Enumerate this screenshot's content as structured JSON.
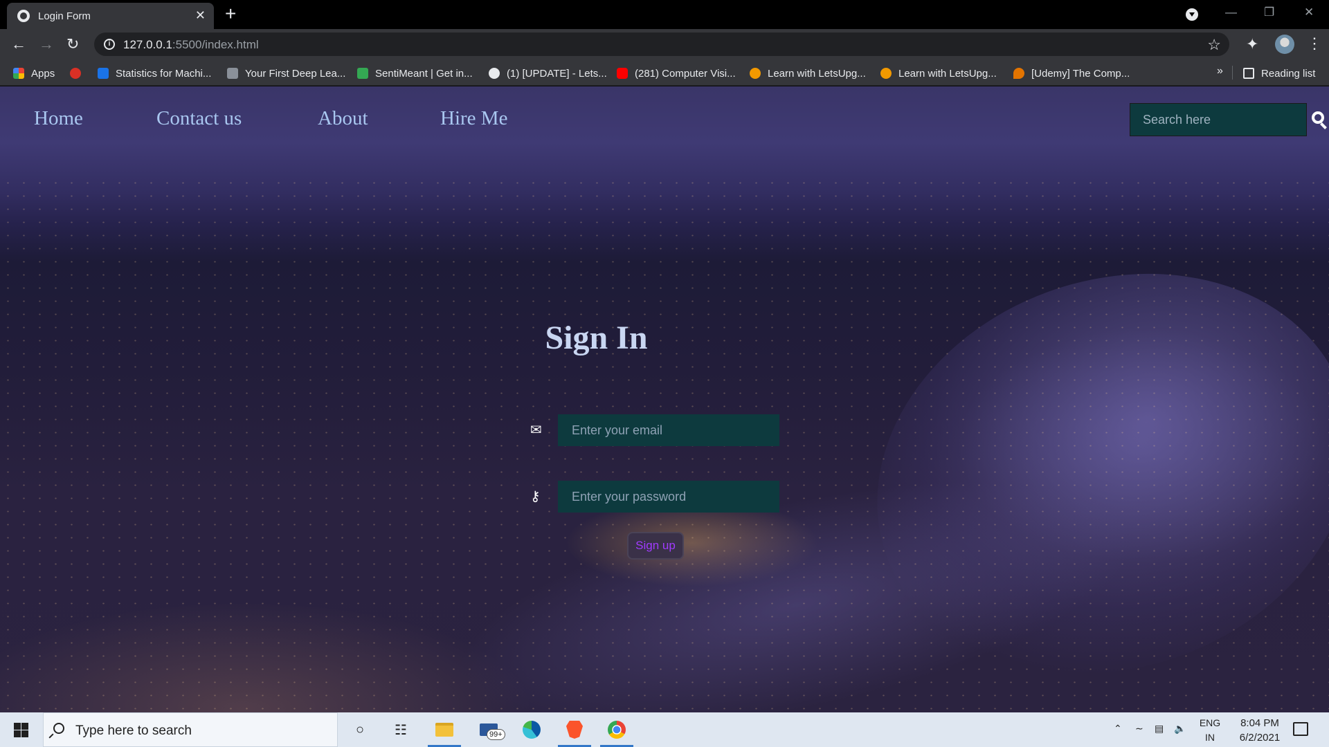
{
  "browser": {
    "tab_title": "Login Form",
    "close_symbol": "✕",
    "new_tab_symbol": "+",
    "url_host": "127.0.0.1",
    "url_path": ":5500/index.html",
    "bookmarks": [
      {
        "label": "Apps",
        "icon": "apps-grid-icon",
        "color": "#ea4335"
      },
      {
        "label": "",
        "icon": "circle-favicon-icon",
        "color": "#d93025"
      },
      {
        "label": "Statistics for Machi...",
        "icon": "gl-favicon-icon",
        "color": "#1a73e8"
      },
      {
        "label": "Your First Deep Lea...",
        "icon": "image-favicon-icon",
        "color": "#5f6368"
      },
      {
        "label": "SentiMeant | Get in...",
        "icon": "chart-favicon-icon",
        "color": "#34a853"
      },
      {
        "label": "(1) [UPDATE] - Lets...",
        "icon": "globe-favicon-icon",
        "color": "#e8eaed"
      },
      {
        "label": "(281) Computer Visi...",
        "icon": "youtube-icon",
        "color": "#ff0000"
      },
      {
        "label": "Learn with LetsUpg...",
        "icon": "letsupgrade-icon",
        "color": "#f29900"
      },
      {
        "label": "Learn with LetsUpg...",
        "icon": "letsupgrade-icon",
        "color": "#f29900"
      },
      {
        "label": "[Udemy] The Comp...",
        "icon": "udemy-pin-icon",
        "color": "#e37400"
      }
    ],
    "more_symbol": "»",
    "reading_list": "Reading list"
  },
  "page": {
    "nav": [
      "Home",
      "Contact us",
      "About",
      "Hire Me"
    ],
    "search_placeholder": "Search here",
    "title": "Sign In",
    "email_placeholder": "Enter your email",
    "password_placeholder": "Enter your password",
    "submit_label": "Sign up",
    "colors": {
      "nav_text": "#a9c7f0",
      "input_bg": "#0d3a3e",
      "button_text": "#a13bff"
    }
  },
  "taskbar": {
    "search_placeholder": "Type here to search",
    "mail_badge": "99+",
    "lang_line1": "ENG",
    "lang_line2": "IN",
    "time": "8:04 PM",
    "date": "6/2/2021"
  }
}
